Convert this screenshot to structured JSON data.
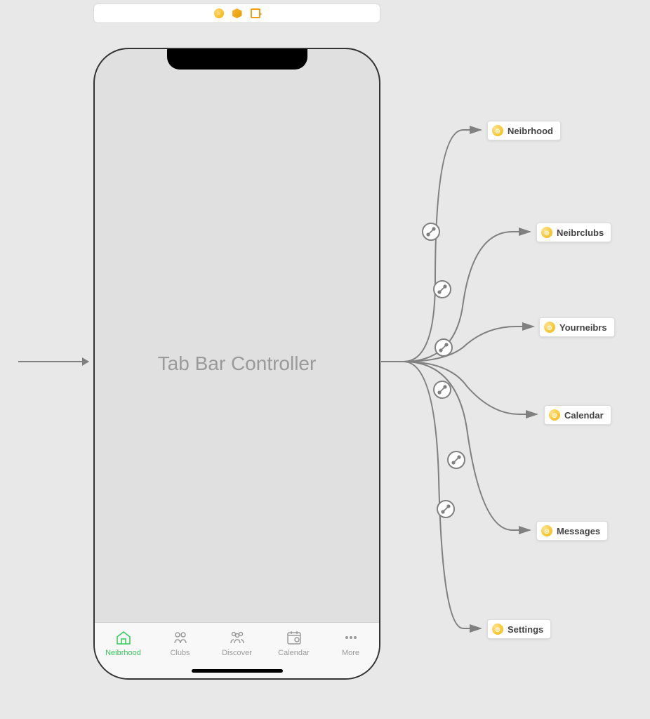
{
  "toolbar": {
    "icons": [
      "home-circle",
      "cube",
      "exit"
    ]
  },
  "phone": {
    "title": "Tab Bar Controller",
    "tabs": [
      {
        "label": "Neibrhood",
        "selected": true
      },
      {
        "label": "Clubs",
        "selected": false
      },
      {
        "label": "Discover",
        "selected": false
      },
      {
        "label": "Calendar",
        "selected": false
      },
      {
        "label": "More",
        "selected": false
      }
    ]
  },
  "destinations": [
    {
      "label": "Neibrhood"
    },
    {
      "label": "Neibrclubs"
    },
    {
      "label": "Yourneibrs"
    },
    {
      "label": "Calendar"
    },
    {
      "label": "Messages"
    },
    {
      "label": "Settings"
    }
  ]
}
